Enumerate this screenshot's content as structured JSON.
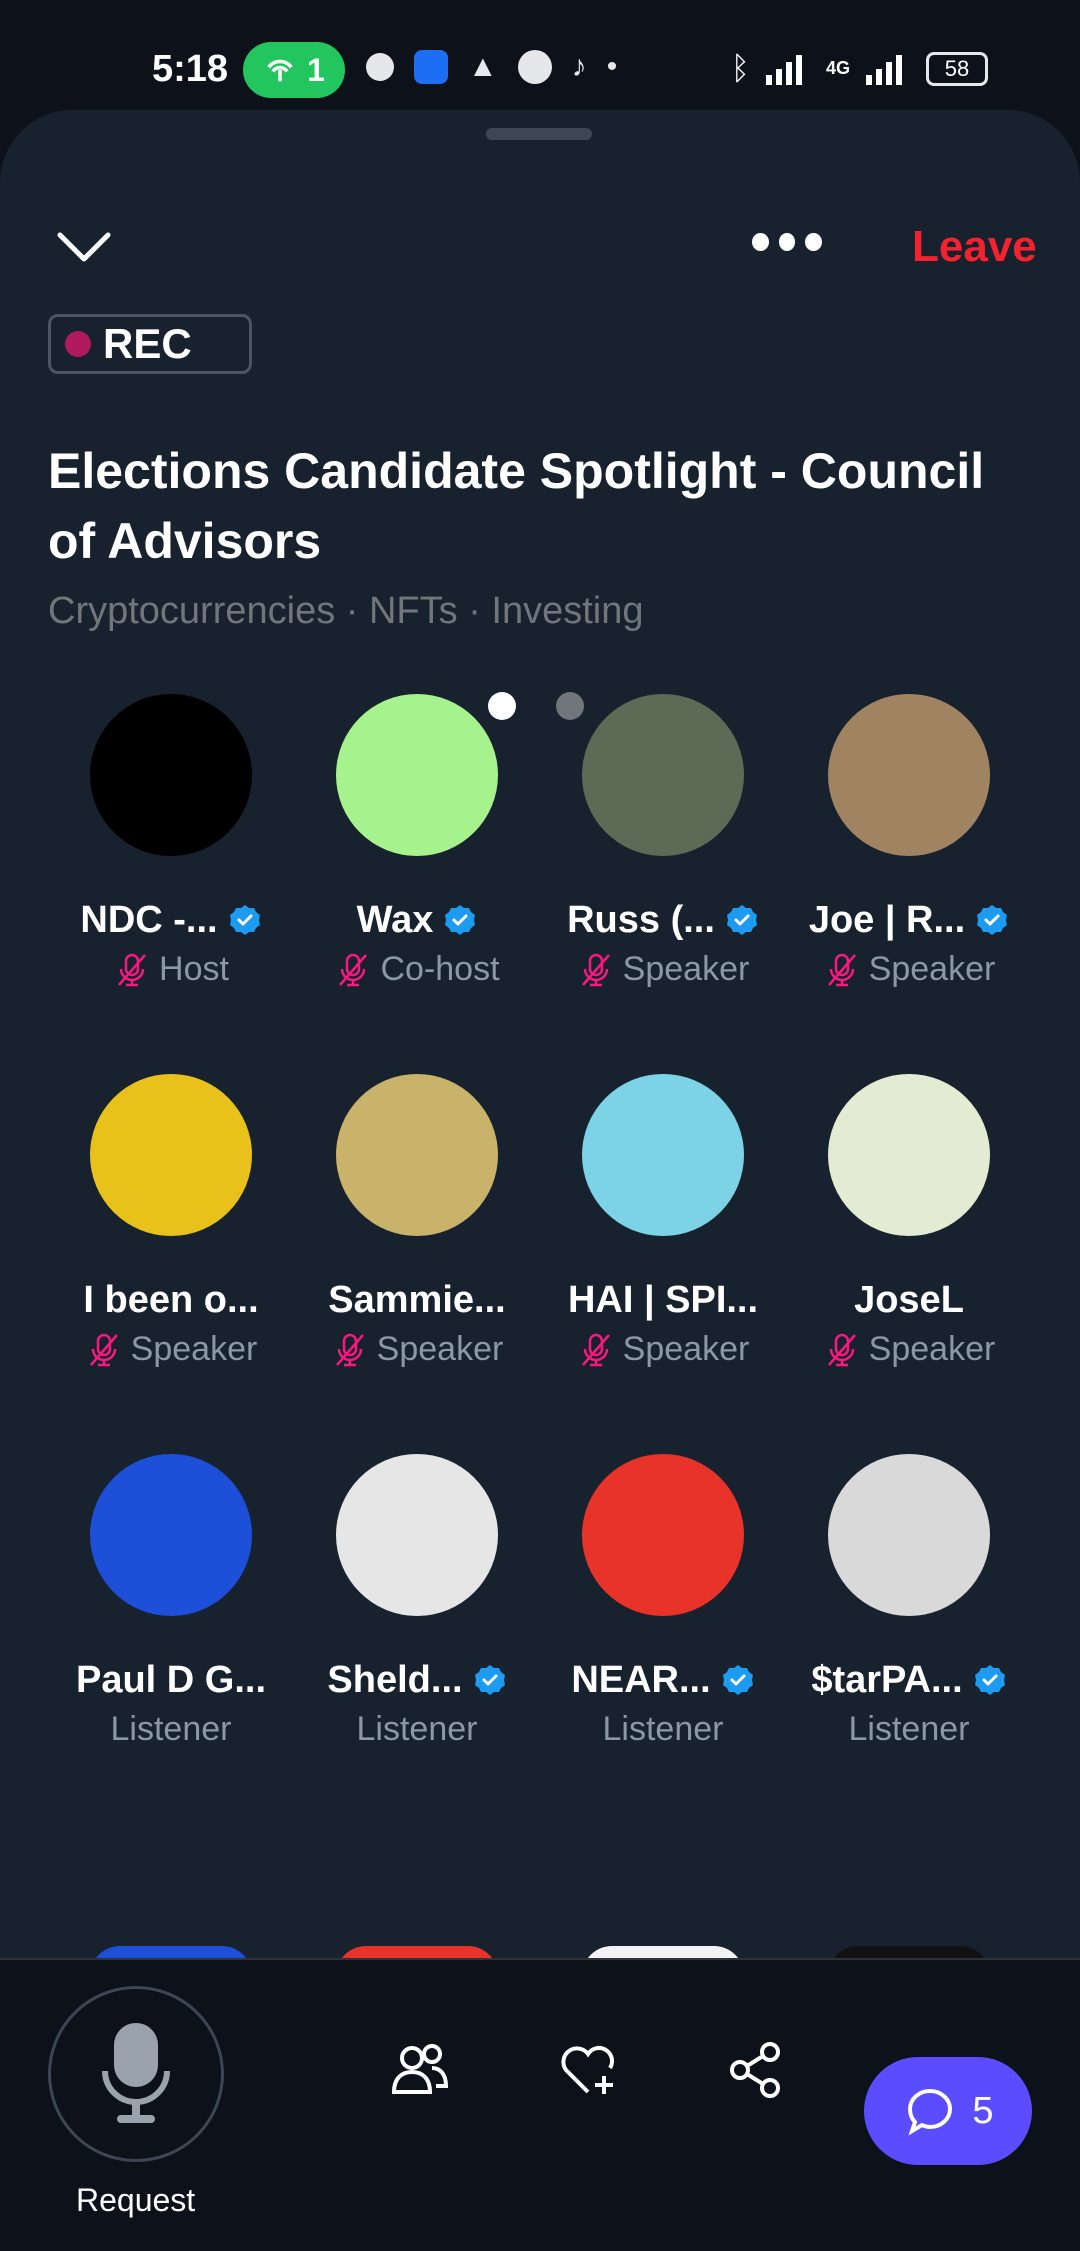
{
  "status_bar": {
    "time": "5:18",
    "hotspot_count": "1",
    "battery": "58",
    "network": "4G"
  },
  "header": {
    "leave_label": "Leave",
    "rec_label": "REC"
  },
  "space": {
    "title": "Elections Candidate Spotlight - Council of Advisors",
    "topics": "Cryptocurrencies · NFTs · Investing"
  },
  "participants": [
    {
      "name": "NDC -...",
      "role": "Host",
      "verified": true,
      "muted": true,
      "avatar_color": "#000000"
    },
    {
      "name": "Wax",
      "role": "Co-host",
      "verified": true,
      "muted": true,
      "avatar_color": "#a6f28c"
    },
    {
      "name": "Russ (...",
      "role": "Speaker",
      "verified": true,
      "muted": true,
      "avatar_color": "#5b6b55"
    },
    {
      "name": "Joe | R...",
      "role": "Speaker",
      "verified": true,
      "muted": true,
      "avatar_color": "#a08462"
    },
    {
      "name": "I been o...",
      "role": "Speaker",
      "verified": false,
      "muted": true,
      "avatar_color": "#e8c21b"
    },
    {
      "name": "Sammie...",
      "role": "Speaker",
      "verified": false,
      "muted": true,
      "avatar_color": "#c9b26a"
    },
    {
      "name": "HAI | SPI...",
      "role": "Speaker",
      "verified": false,
      "muted": true,
      "avatar_color": "#7cd3e6"
    },
    {
      "name": "JoseL",
      "role": "Speaker",
      "verified": false,
      "muted": true,
      "avatar_color": "#e3ebd3"
    },
    {
      "name": "Paul D G...",
      "role": "Listener",
      "verified": false,
      "muted": false,
      "avatar_color": "#1d4fd8"
    },
    {
      "name": "Sheld...",
      "role": "Listener",
      "verified": true,
      "muted": false,
      "avatar_color": "#e6e6e6"
    },
    {
      "name": "NEAR...",
      "role": "Listener",
      "verified": true,
      "muted": false,
      "avatar_color": "#e8332a"
    },
    {
      "name": "$tarPA...",
      "role": "Listener",
      "verified": true,
      "muted": false,
      "avatar_color": "#d9d9d9"
    }
  ],
  "bottom_bar": {
    "request_label": "Request",
    "comments_count": "5"
  },
  "colors": {
    "accent": "#1d9bf0",
    "leave": "#f4212e",
    "muted_icon": "#f91880",
    "chat_button": "#5b4dff"
  }
}
